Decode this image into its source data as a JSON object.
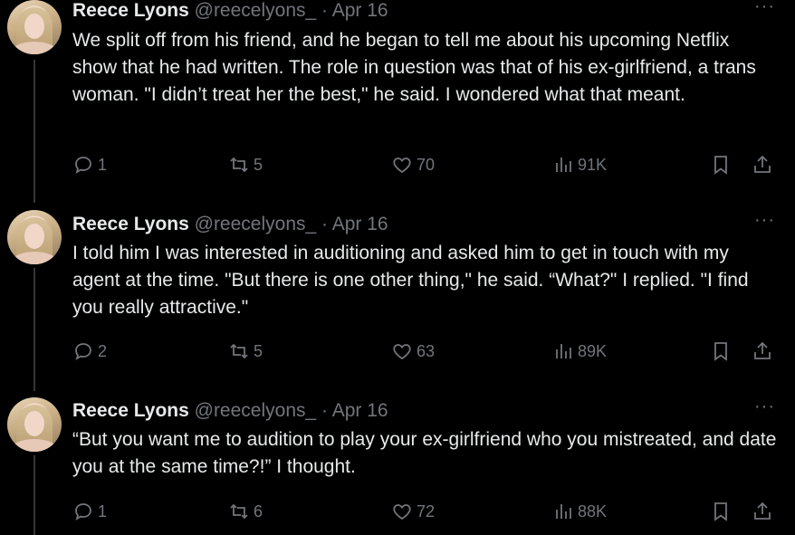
{
  "tweets": [
    {
      "name": "Reece Lyons",
      "handle": "@reecelyons_",
      "separator": "·",
      "date": "Apr 16",
      "more": "···",
      "text": "We split off from his friend, and he began to tell me about his upcoming Netflix show that he had written. The role in question was that of his ex-girlfriend, a trans woman. \"I didn’t treat her the best,\" he said. I wondered what that meant.",
      "replies": "1",
      "retweets": "5",
      "likes": "70",
      "views": "91K"
    },
    {
      "name": "Reece Lyons",
      "handle": "@reecelyons_",
      "separator": "·",
      "date": "Apr 16",
      "more": "···",
      "text": "I told him I was interested in auditioning and asked him to get in touch with my agent at the time. \"But there is one other thing,\" he said. “What?\" I replied. \"I find you really attractive.\"",
      "replies": "2",
      "retweets": "5",
      "likes": "63",
      "views": "89K"
    },
    {
      "name": "Reece Lyons",
      "handle": "@reecelyons_",
      "separator": "·",
      "date": "Apr 16",
      "more": "···",
      "text": "“But you want me to audition to play your ex-girlfriend who you mistreated, and date you at the same time?!” I thought.",
      "replies": "1",
      "retweets": "6",
      "likes": "72",
      "views": "88K"
    }
  ],
  "icons": {
    "reply": "reply-icon",
    "retweet": "retweet-icon",
    "like": "heart-icon",
    "views": "views-icon",
    "bookmark": "bookmark-icon",
    "share": "share-icon"
  },
  "colors": {
    "background": "#000000",
    "text": "#e7e9ea",
    "muted": "#71767b",
    "thread_line": "#333639"
  }
}
